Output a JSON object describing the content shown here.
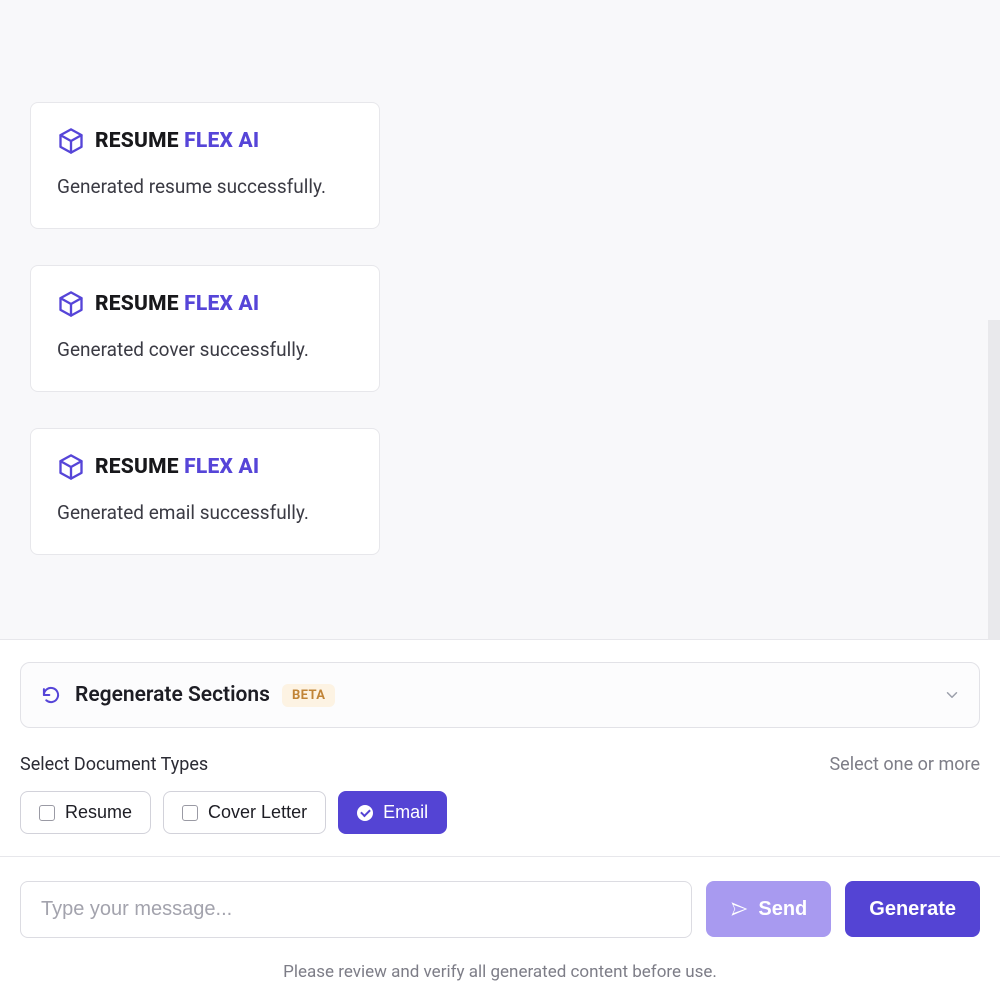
{
  "brand": {
    "text_black": "RESUME ",
    "text_purple": "FLEX AI"
  },
  "messages": [
    {
      "body": "Generated resume successfully."
    },
    {
      "body": "Generated cover successfully."
    },
    {
      "body": "Generated email successfully."
    }
  ],
  "regenerate": {
    "label": "Regenerate Sections",
    "badge": "BETA"
  },
  "docTypes": {
    "label": "Select Document Types",
    "hint": "Select one or more",
    "options": [
      {
        "label": "Resume",
        "selected": false
      },
      {
        "label": "Cover Letter",
        "selected": false
      },
      {
        "label": "Email",
        "selected": true
      }
    ]
  },
  "compose": {
    "placeholder": "Type your message...",
    "send_label": "Send",
    "generate_label": "Generate"
  },
  "disclaimer": "Please review and verify all generated content before use."
}
